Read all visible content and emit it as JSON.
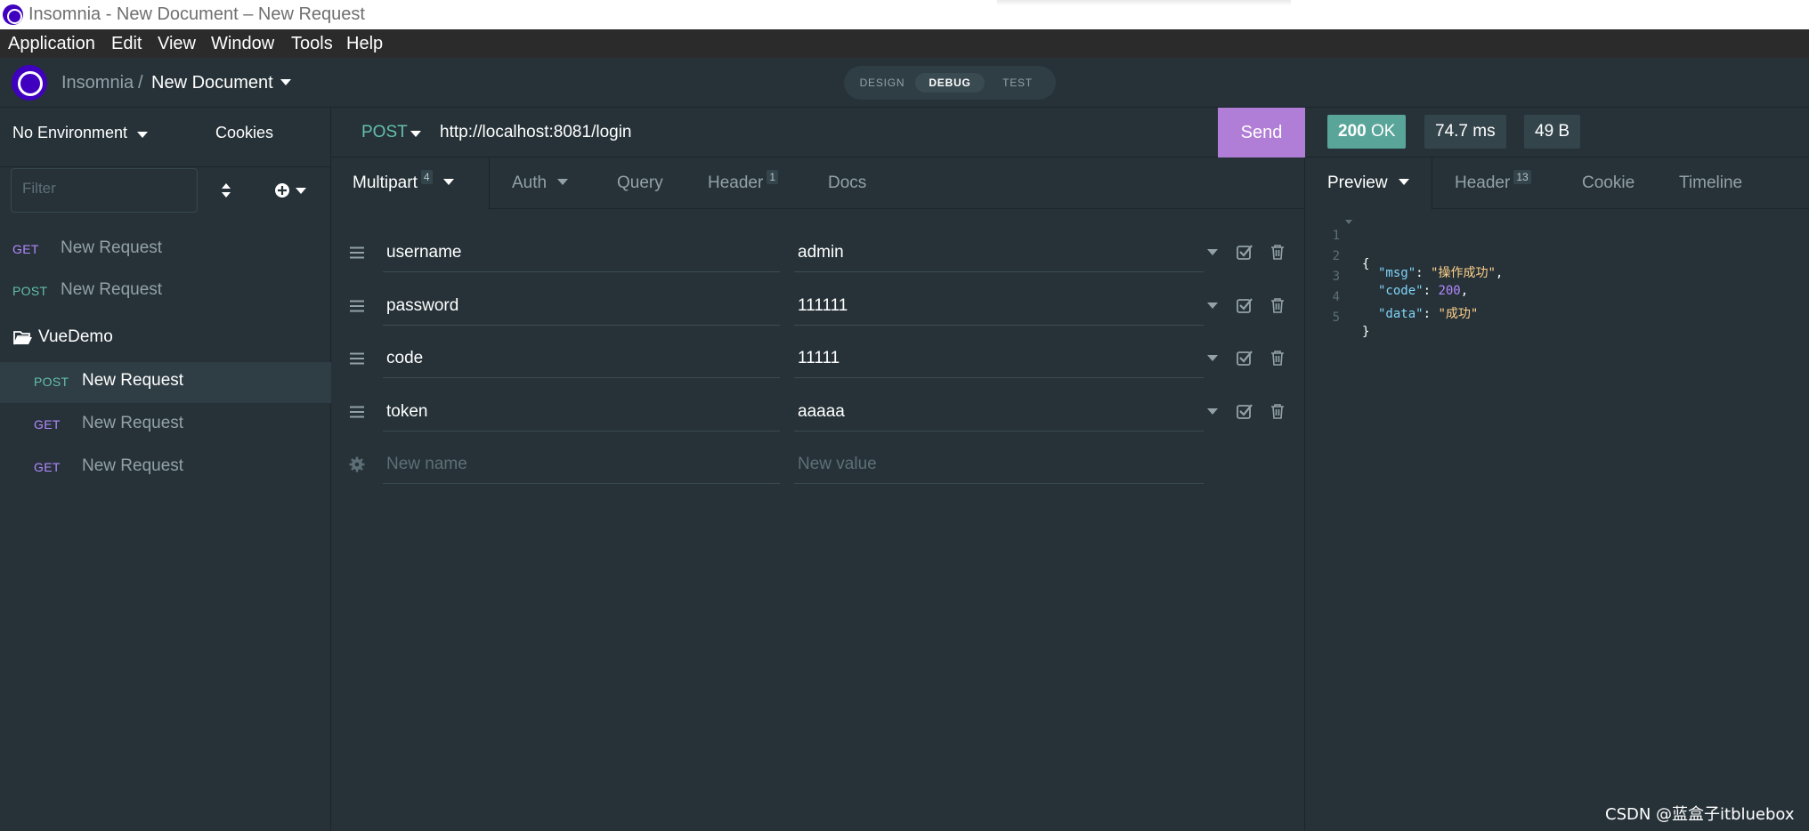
{
  "window": {
    "title": "Insomnia - New Document – New Request"
  },
  "menu": [
    "Application",
    "Edit",
    "View",
    "Window",
    "Tools",
    "Help"
  ],
  "header": {
    "workspace": "Insomnia",
    "separator": "/",
    "document": "New Document",
    "modes": [
      "DESIGN",
      "DEBUG",
      "TEST"
    ],
    "active_mode": "DEBUG"
  },
  "sidebar": {
    "environment": "No Environment",
    "cookies": "Cookies",
    "filter_placeholder": "Filter",
    "requests": [
      {
        "method": "GET",
        "name": "New Request"
      },
      {
        "method": "POST",
        "name": "New Request"
      }
    ],
    "folder": {
      "name": "VueDemo",
      "requests": [
        {
          "method": "POST",
          "name": "New Request",
          "active": true
        },
        {
          "method": "GET",
          "name": "New Request"
        },
        {
          "method": "GET",
          "name": "New Request"
        }
      ]
    }
  },
  "request": {
    "method": "POST",
    "url": "http://localhost:8081/login",
    "send_label": "Send",
    "tabs": {
      "body": {
        "label": "Multipart",
        "count": "4"
      },
      "auth": {
        "label": "Auth"
      },
      "query": {
        "label": "Query"
      },
      "header": {
        "label": "Header",
        "count": "1"
      },
      "docs": {
        "label": "Docs"
      }
    },
    "params": [
      {
        "name": "username",
        "value": "admin"
      },
      {
        "name": "password",
        "value": "111111"
      },
      {
        "name": "code",
        "value": "11111"
      },
      {
        "name": "token",
        "value": "aaaaa"
      }
    ],
    "new_name_placeholder": "New name",
    "new_value_placeholder": "New value"
  },
  "response": {
    "status": {
      "code": "200",
      "text": "OK"
    },
    "time": "74.7 ms",
    "size": "49 B",
    "tabs": {
      "preview": {
        "label": "Preview"
      },
      "header": {
        "label": "Header",
        "count": "13"
      },
      "cookie": {
        "label": "Cookie"
      },
      "timeline": {
        "label": "Timeline"
      }
    },
    "body_lines": [
      "1",
      "2",
      "3",
      "4",
      "5"
    ],
    "body": {
      "open": "{",
      "msg_key": "\"msg\"",
      "msg_val": "\"操作成功\"",
      "code_key": "\"code\"",
      "code_val": "200",
      "data_key": "\"data\"",
      "data_val": "\"成功\"",
      "close": "}"
    }
  },
  "watermark": "CSDN @蓝盒子itbluebox",
  "colors": {
    "background": "#263238",
    "send_button": "#b07ed6",
    "status_ok": "#59a59a",
    "method_get": "#b388ff",
    "method_post": "#64bfad",
    "brand": "#4000bf"
  }
}
